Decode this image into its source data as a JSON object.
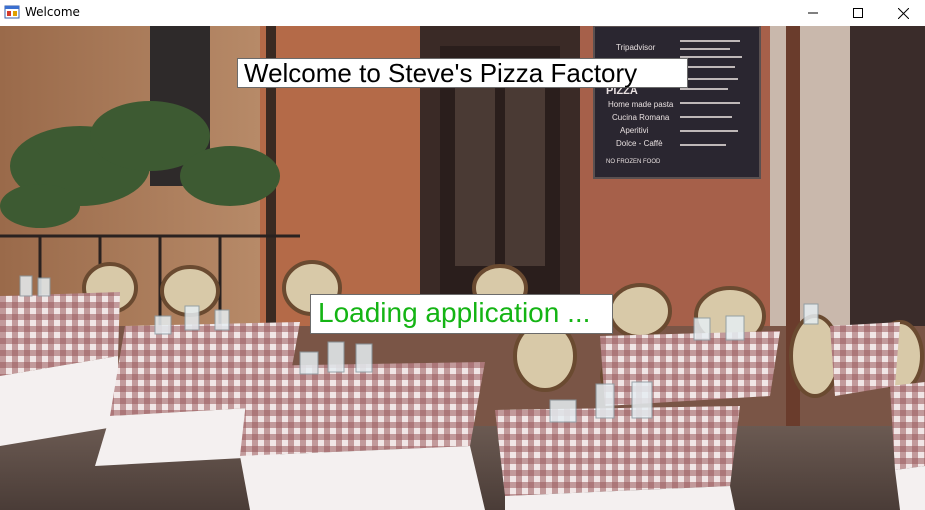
{
  "window": {
    "title": "Welcome",
    "icon": "app-window-icon",
    "controls": [
      "minimize-icon",
      "maximize-icon",
      "close-icon"
    ]
  },
  "main": {
    "welcome_text": "Welcome to Steve's Pizza Factory",
    "loading_text": "Loading application ...",
    "loading_color": "#14b414"
  },
  "background": {
    "menu_board_lines": [
      "Tripadvisor",
      "PIZZA",
      "Home made pasta",
      "Cucina Romana",
      "Aperitivi",
      "Dolce - Caffè",
      "NO FROZEN FOOD"
    ]
  }
}
